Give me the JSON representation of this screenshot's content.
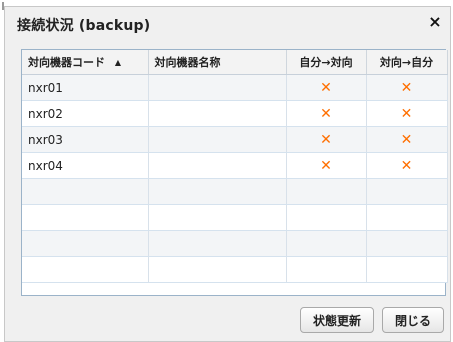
{
  "dialog": {
    "title": "接続状況 (backup)",
    "close_label": "×"
  },
  "table": {
    "headers": [
      "対向機器コード",
      "対向機器名称",
      "自分→対向",
      "対向→自分"
    ],
    "sort_indicator": "▲",
    "rows": [
      {
        "code": "nxr01",
        "name": "",
        "self_to_peer": "✕",
        "peer_to_self": "✕"
      },
      {
        "code": "nxr02",
        "name": "",
        "self_to_peer": "✕",
        "peer_to_self": "✕"
      },
      {
        "code": "nxr03",
        "name": "",
        "self_to_peer": "✕",
        "peer_to_self": "✕"
      },
      {
        "code": "nxr04",
        "name": "",
        "self_to_peer": "✕",
        "peer_to_self": "✕"
      }
    ]
  },
  "buttons": {
    "refresh_label": "状態更新",
    "close_label": "閉じる"
  },
  "colors": {
    "x_mark": "#ff6f00",
    "grid_line": "#d5e2ee"
  }
}
